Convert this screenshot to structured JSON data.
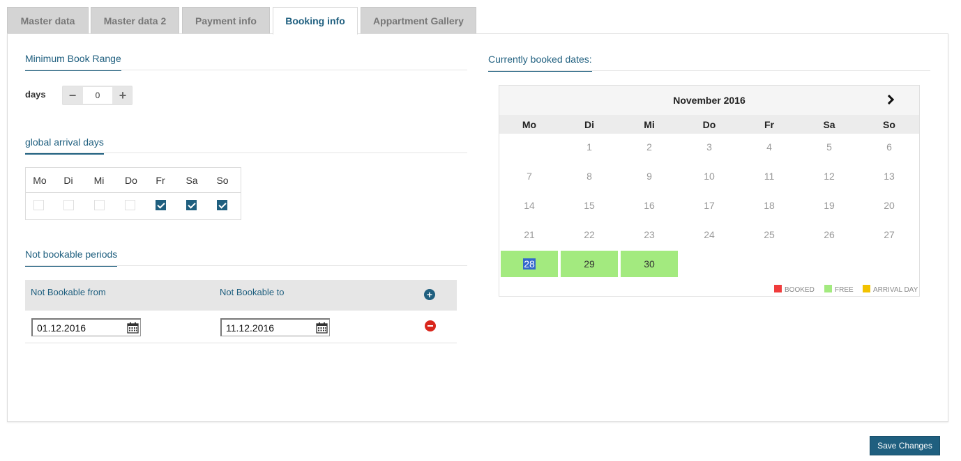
{
  "tabs": [
    {
      "label": "Master data"
    },
    {
      "label": "Master data 2"
    },
    {
      "label": "Payment info"
    },
    {
      "label": "Booking info",
      "active": true
    },
    {
      "label": "Appartment Gallery"
    }
  ],
  "min_book": {
    "title": "Minimum Book Range",
    "days_label": "days",
    "value": "0",
    "minus": "−",
    "plus": "+"
  },
  "arrival": {
    "title": "global arrival days",
    "days": [
      {
        "label": "Mo",
        "checked": false
      },
      {
        "label": "Di",
        "checked": false
      },
      {
        "label": "Mi",
        "checked": false
      },
      {
        "label": "Do",
        "checked": false
      },
      {
        "label": "Fr",
        "checked": true
      },
      {
        "label": "Sa",
        "checked": true
      },
      {
        "label": "So",
        "checked": true
      }
    ]
  },
  "periods": {
    "title": "Not bookable periods",
    "col_from": "Not Bookable from",
    "col_to": "Not Bookable to",
    "rows": [
      {
        "from": "01.12.2016",
        "to": "11.12.2016"
      }
    ]
  },
  "calendar": {
    "title": "Currently booked dates:",
    "month": "November 2016",
    "weekdays": [
      "Mo",
      "Di",
      "Mi",
      "Do",
      "Fr",
      "Sa",
      "So"
    ],
    "weeks": [
      [
        "",
        "1",
        "2",
        "3",
        "4",
        "5",
        "6"
      ],
      [
        "7",
        "8",
        "9",
        "10",
        "11",
        "12",
        "13"
      ],
      [
        "14",
        "15",
        "16",
        "17",
        "18",
        "19",
        "20"
      ],
      [
        "21",
        "22",
        "23",
        "24",
        "25",
        "26",
        "27"
      ],
      [
        "28",
        "29",
        "30",
        "",
        "",
        "",
        ""
      ]
    ],
    "free_days": [
      "28",
      "29",
      "30"
    ],
    "selected_day": "28",
    "legend": [
      {
        "label": "BOOKED",
        "color": "#f03c3c"
      },
      {
        "label": "FREE",
        "color": "#a3ea7f"
      },
      {
        "label": "ARRIVAL DAY",
        "color": "#f2c200"
      }
    ]
  },
  "save_label": "Save Changes"
}
